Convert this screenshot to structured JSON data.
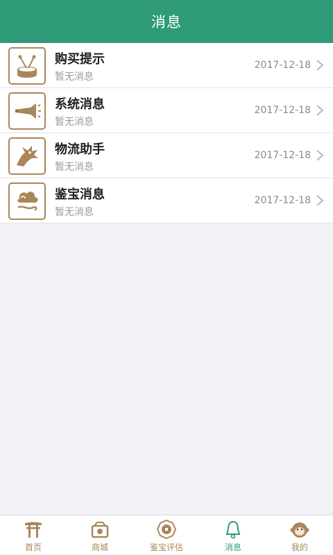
{
  "header": {
    "title": "消息"
  },
  "messages": [
    {
      "title": "购买提示",
      "subtitle": "暂无消息",
      "date": "2017-12-18",
      "icon": "drum-icon"
    },
    {
      "title": "系统消息",
      "subtitle": "暂无消息",
      "date": "2017-12-18",
      "icon": "horn-icon"
    },
    {
      "title": "物流助手",
      "subtitle": "暂无消息",
      "date": "2017-12-18",
      "icon": "dragon-icon"
    },
    {
      "title": "鉴宝消息",
      "subtitle": "暂无消息",
      "date": "2017-12-18",
      "icon": "cloud-icon"
    }
  ],
  "tabs": [
    {
      "label": "首页",
      "icon": "gate-icon",
      "active": false
    },
    {
      "label": "商城",
      "icon": "shop-icon",
      "active": false
    },
    {
      "label": "鉴宝评估",
      "icon": "coin-icon",
      "active": false
    },
    {
      "label": "消息",
      "icon": "bell-icon",
      "active": true
    },
    {
      "label": "我的",
      "icon": "monkey-icon",
      "active": false
    }
  ],
  "colors": {
    "accent": "#2e9a78",
    "gold": "#a9875a",
    "background": "#f2f2f6"
  }
}
